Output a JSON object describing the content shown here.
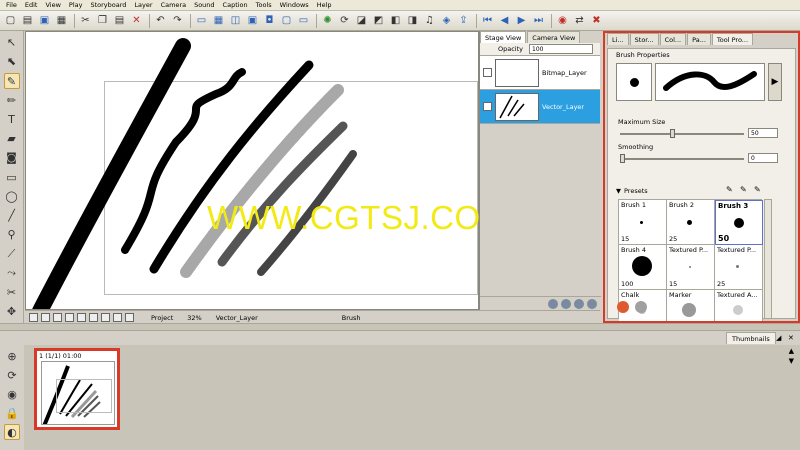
{
  "menubar": [
    "File",
    "Edit",
    "View",
    "Play",
    "Storyboard",
    "Layer",
    "Camera",
    "Sound",
    "Caption",
    "Tools",
    "Windows",
    "Help"
  ],
  "stage_panel": {
    "tabs": [
      "Stage View",
      "Camera View"
    ],
    "opacity_label": "Opacity",
    "opacity_value": "100",
    "layers": [
      {
        "name": "Bitmap_Layer",
        "selected": false
      },
      {
        "name": "Vector_Layer",
        "selected": true
      }
    ]
  },
  "watermark": "WWW.CGTSJ.COM",
  "statusbar": {
    "project": "Project",
    "zoom": "32%",
    "layer": "Vector_Layer",
    "tool": "Brush"
  },
  "tool_properties": {
    "tabs": [
      "Li...",
      "Stor...",
      "Col...",
      "Pa...",
      "Tool Pro..."
    ],
    "title": "Brush Properties",
    "max_size_label": "Maximum Size",
    "max_size_value": "50",
    "max_size_fraction": 0.4,
    "smoothing_label": "Smoothing",
    "smoothing_value": "0",
    "smoothing_fraction": 0,
    "presets_label": "Presets",
    "presets": [
      {
        "name": "Brush 1",
        "size": "15",
        "selected": false
      },
      {
        "name": "Brush 2",
        "size": "25",
        "selected": false
      },
      {
        "name": "Brush 3",
        "size": "50",
        "selected": true
      },
      {
        "name": "Brush 4",
        "size": "100",
        "selected": false
      },
      {
        "name": "Textured P...",
        "size": "15",
        "selected": false
      },
      {
        "name": "Textured P...",
        "size": "25",
        "selected": false
      },
      {
        "name": "Chalk",
        "size": "",
        "selected": false
      },
      {
        "name": "Marker",
        "size": "",
        "selected": false
      },
      {
        "name": "Textured A...",
        "size": "",
        "selected": false
      }
    ]
  },
  "thumbnails": {
    "tab": "Thumbnails",
    "panel_label": "1 (1/1) 01:00"
  }
}
